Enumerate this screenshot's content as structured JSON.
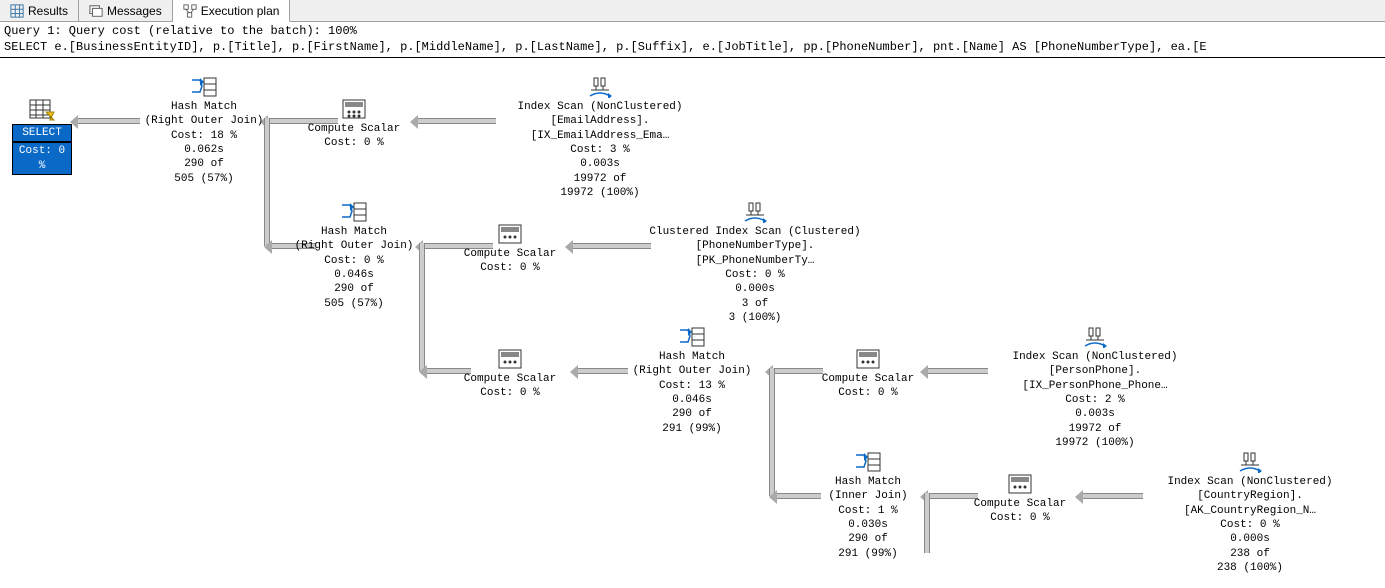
{
  "tabs": {
    "results": "Results",
    "messages": "Messages",
    "plan": "Execution plan"
  },
  "query_header": {
    "line1": "Query 1: Query cost (relative to the batch): 100%",
    "line2": "SELECT e.[BusinessEntityID], p.[Title], p.[FirstName], p.[MiddleName], p.[LastName], p.[Suffix], e.[JobTitle], pp.[PhoneNumber], pnt.[Name] AS [PhoneNumberType], ea.[E"
  },
  "nodes": {
    "select": {
      "label": "SELECT",
      "cost": "Cost: 0 %"
    },
    "hm1": {
      "l1": "Hash Match",
      "l2": "(Right Outer Join)",
      "l3": "Cost: 18 %",
      "l4": "0.062s",
      "l5": "290 of",
      "l6": "505 (57%)"
    },
    "cs1": {
      "l1": "Compute Scalar",
      "l2": "Cost: 0 %"
    },
    "idx1": {
      "l1": "Index Scan (NonClustered)",
      "l2": "[EmailAddress].[IX_EmailAddress_Ema…",
      "l3": "Cost: 3 %",
      "l4": "0.003s",
      "l5": "19972 of",
      "l6": "19972 (100%)"
    },
    "hm2": {
      "l1": "Hash Match",
      "l2": "(Right Outer Join)",
      "l3": "Cost: 0 %",
      "l4": "0.046s",
      "l5": "290 of",
      "l6": "505 (57%)"
    },
    "cs2": {
      "l1": "Compute Scalar",
      "l2": "Cost: 0 %"
    },
    "idx2": {
      "l1": "Clustered Index Scan (Clustered)",
      "l2": "[PhoneNumberType].[PK_PhoneNumberTy…",
      "l3": "Cost: 0 %",
      "l4": "0.000s",
      "l5": "3 of",
      "l6": "3 (100%)"
    },
    "cs3": {
      "l1": "Compute Scalar",
      "l2": "Cost: 0 %"
    },
    "hm3": {
      "l1": "Hash Match",
      "l2": "(Right Outer Join)",
      "l3": "Cost: 13 %",
      "l4": "0.046s",
      "l5": "290 of",
      "l6": "291 (99%)"
    },
    "cs4": {
      "l1": "Compute Scalar",
      "l2": "Cost: 0 %"
    },
    "idx3": {
      "l1": "Index Scan (NonClustered)",
      "l2": "[PersonPhone].[IX_PersonPhone_Phone…",
      "l3": "Cost: 2 %",
      "l4": "0.003s",
      "l5": "19972 of",
      "l6": "19972 (100%)"
    },
    "hm4": {
      "l1": "Hash Match",
      "l2": "(Inner Join)",
      "l3": "Cost: 1 %",
      "l4": "0.030s",
      "l5": "290 of",
      "l6": "291 (99%)"
    },
    "cs5": {
      "l1": "Compute Scalar",
      "l2": "Cost: 0 %"
    },
    "idx4": {
      "l1": "Index Scan (NonClustered)",
      "l2": "[CountryRegion].[AK_CountryRegion_N…",
      "l3": "Cost: 0 %",
      "l4": "0.000s",
      "l5": "238 of",
      "l6": "238 (100%)"
    }
  }
}
